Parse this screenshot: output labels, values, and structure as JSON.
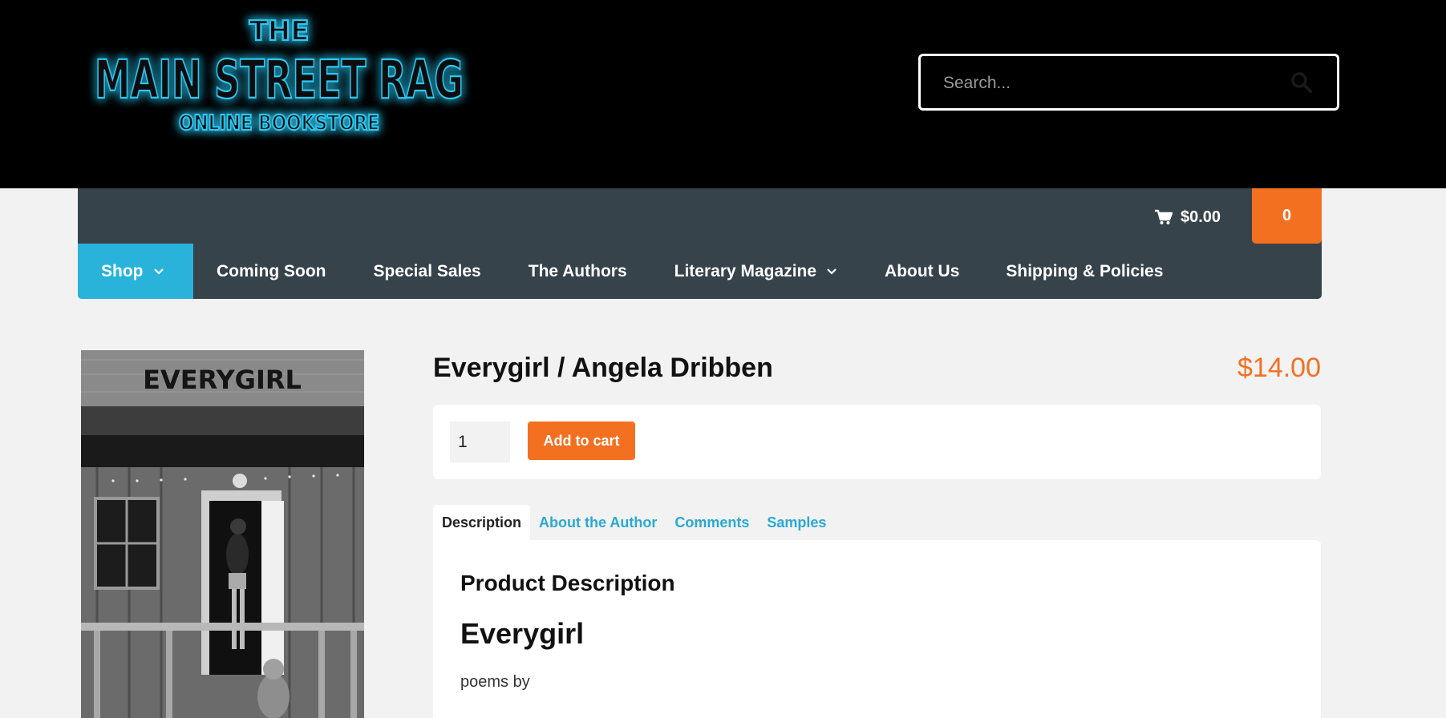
{
  "header": {
    "logo": {
      "line1": "THE",
      "line2": "MAIN STREET RAG",
      "line3": "ONLINE BOOKSTORE"
    },
    "search": {
      "placeholder": "Search...",
      "icon": "search-icon"
    }
  },
  "nav": {
    "cart_total": "$0.00",
    "cart_count": "0",
    "items": [
      {
        "label": "Shop",
        "has_dropdown": true,
        "active": true
      },
      {
        "label": "Coming Soon"
      },
      {
        "label": "Special Sales"
      },
      {
        "label": "The Authors"
      },
      {
        "label": "Literary Magazine",
        "has_dropdown": true
      },
      {
        "label": "About Us"
      },
      {
        "label": "Shipping & Policies"
      }
    ]
  },
  "product": {
    "cover_text": "EVERYGIRL",
    "title": "Everygirl / Angela Dribben",
    "price": "$14.00",
    "quantity": "1",
    "add_to_cart": "Add to cart"
  },
  "tabs": [
    {
      "label": "Description",
      "active": true
    },
    {
      "label": "About the Author"
    },
    {
      "label": "Comments"
    },
    {
      "label": "Samples"
    }
  ],
  "description": {
    "heading": "Product Description",
    "book_title": "Everygirl",
    "byline": "poems by"
  },
  "colors": {
    "accent_orange": "#f37021",
    "accent_blue": "#29b3db",
    "nav_bg": "#37434a",
    "header_bg": "#000000"
  }
}
